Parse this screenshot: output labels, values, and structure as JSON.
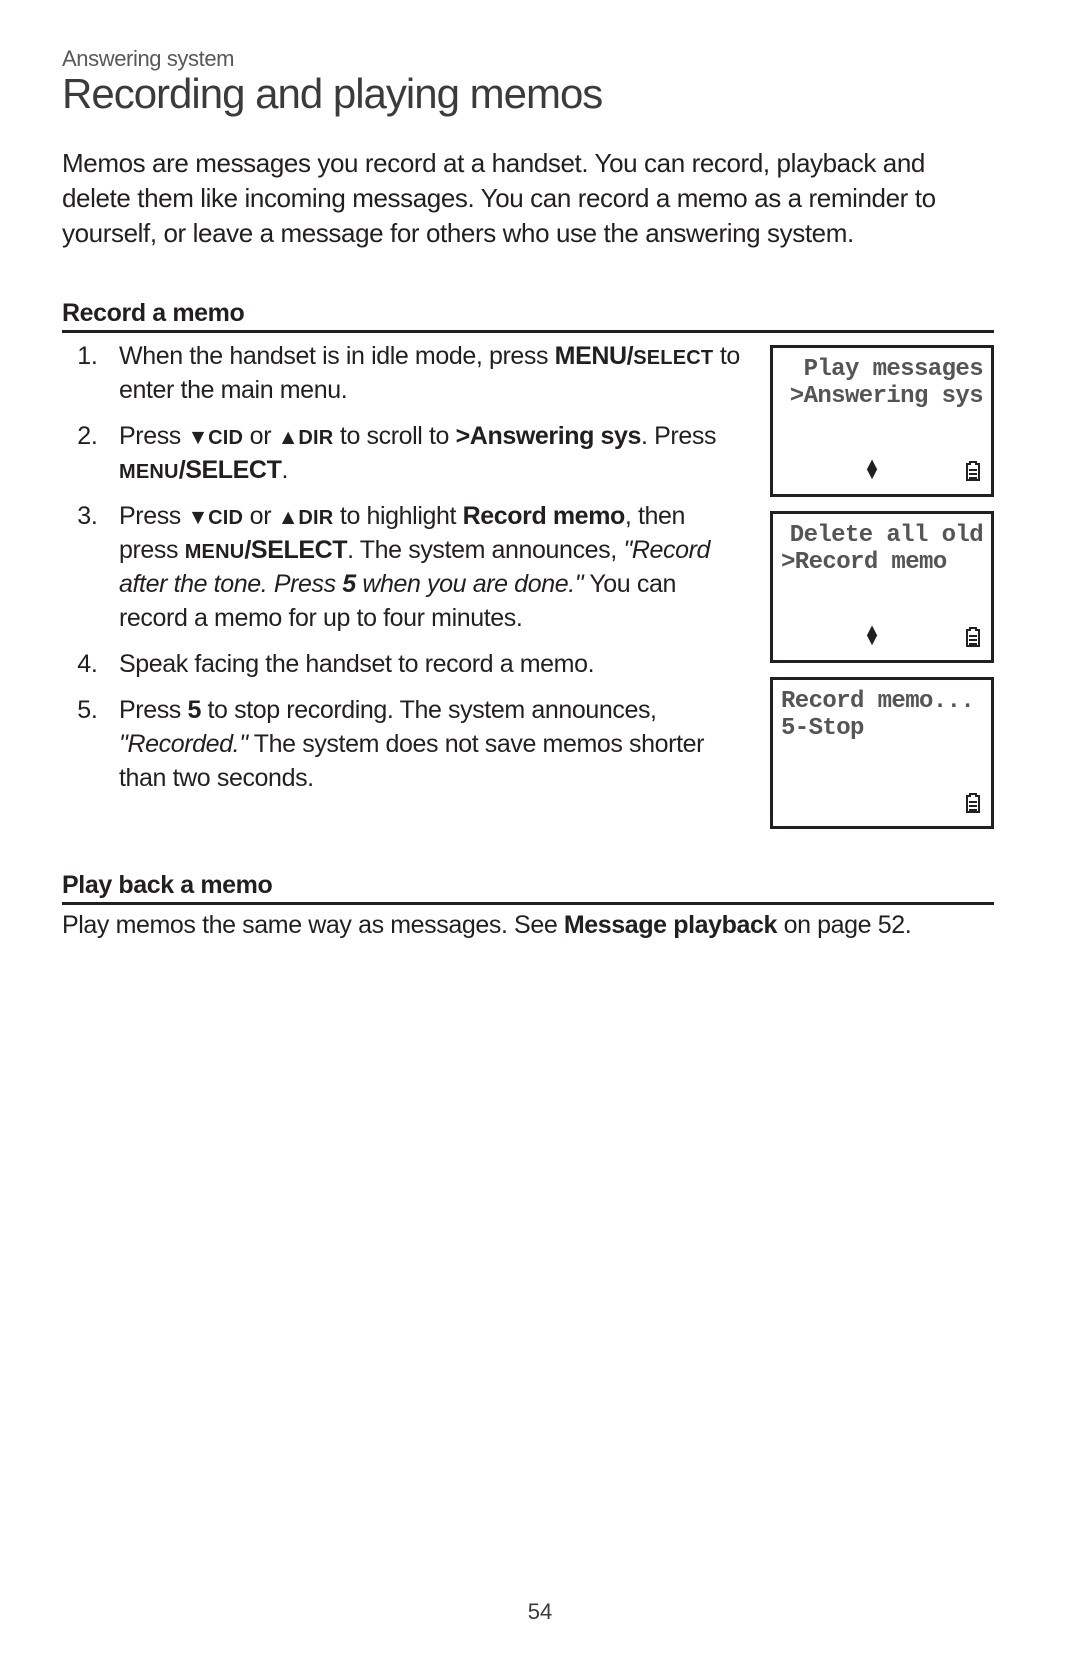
{
  "eyebrow": "Answering system",
  "title": "Recording and playing memos",
  "intro": "Memos are messages you record at a handset. You can record, playback and delete them like incoming messages. You can record a memo as a reminder to yourself, or leave a message for others who use the answering system.",
  "record": {
    "heading": "Record a memo",
    "steps": {
      "s1a": "When the handset is in idle mode, press ",
      "s1b_bold": "MENU/",
      "s1c_sc": "select",
      "s1d": " to enter the main menu.",
      "s2a": "Press ",
      "s2_cid": "cid",
      "s2_or": " or ",
      "s2_dir": "dir",
      "s2b": " to scroll to ",
      "s2c_bold": ">Answering sys",
      "s2d": ". Press ",
      "s2e_sc": "menu",
      "s2f_bold": "/SELECT",
      "s2g": ".",
      "s3a": "Press ",
      "s3b": " to highlight ",
      "s3c_bold": "Record memo",
      "s3d": ", then press ",
      "s3e_sc": "menu",
      "s3f_bold": "/SELECT",
      "s3g": ". The system announces, ",
      "s3h_italic": "\"Record after the tone. Press ",
      "s3i_italic_bold": "5",
      "s3j_italic": " when you are done.\"",
      "s3k": " You can record a memo for up to four minutes.",
      "s4": "Speak facing the handset to record a memo.",
      "s5a": "Press ",
      "s5b_bold": "5",
      "s5c": " to stop recording. The system announces, ",
      "s5d_italic": "\"Recorded.\"",
      "s5e": " The system does not save memos shorter than two seconds."
    }
  },
  "playback": {
    "heading": "Play back a memo",
    "note_a": "Play memos the same way as messages. See ",
    "note_b_bold": "Message playback",
    "note_c": " on page 52."
  },
  "screens": {
    "s1": {
      "line1": "Play messages",
      "line2": ">Answering sys"
    },
    "s2": {
      "line1": "Delete all old",
      "line2": ">Record memo"
    },
    "s3": {
      "line1": "Record memo...",
      "line2": "5-Stop"
    }
  },
  "icons": {
    "down": "▼",
    "up": "▲"
  },
  "page_number": "54"
}
